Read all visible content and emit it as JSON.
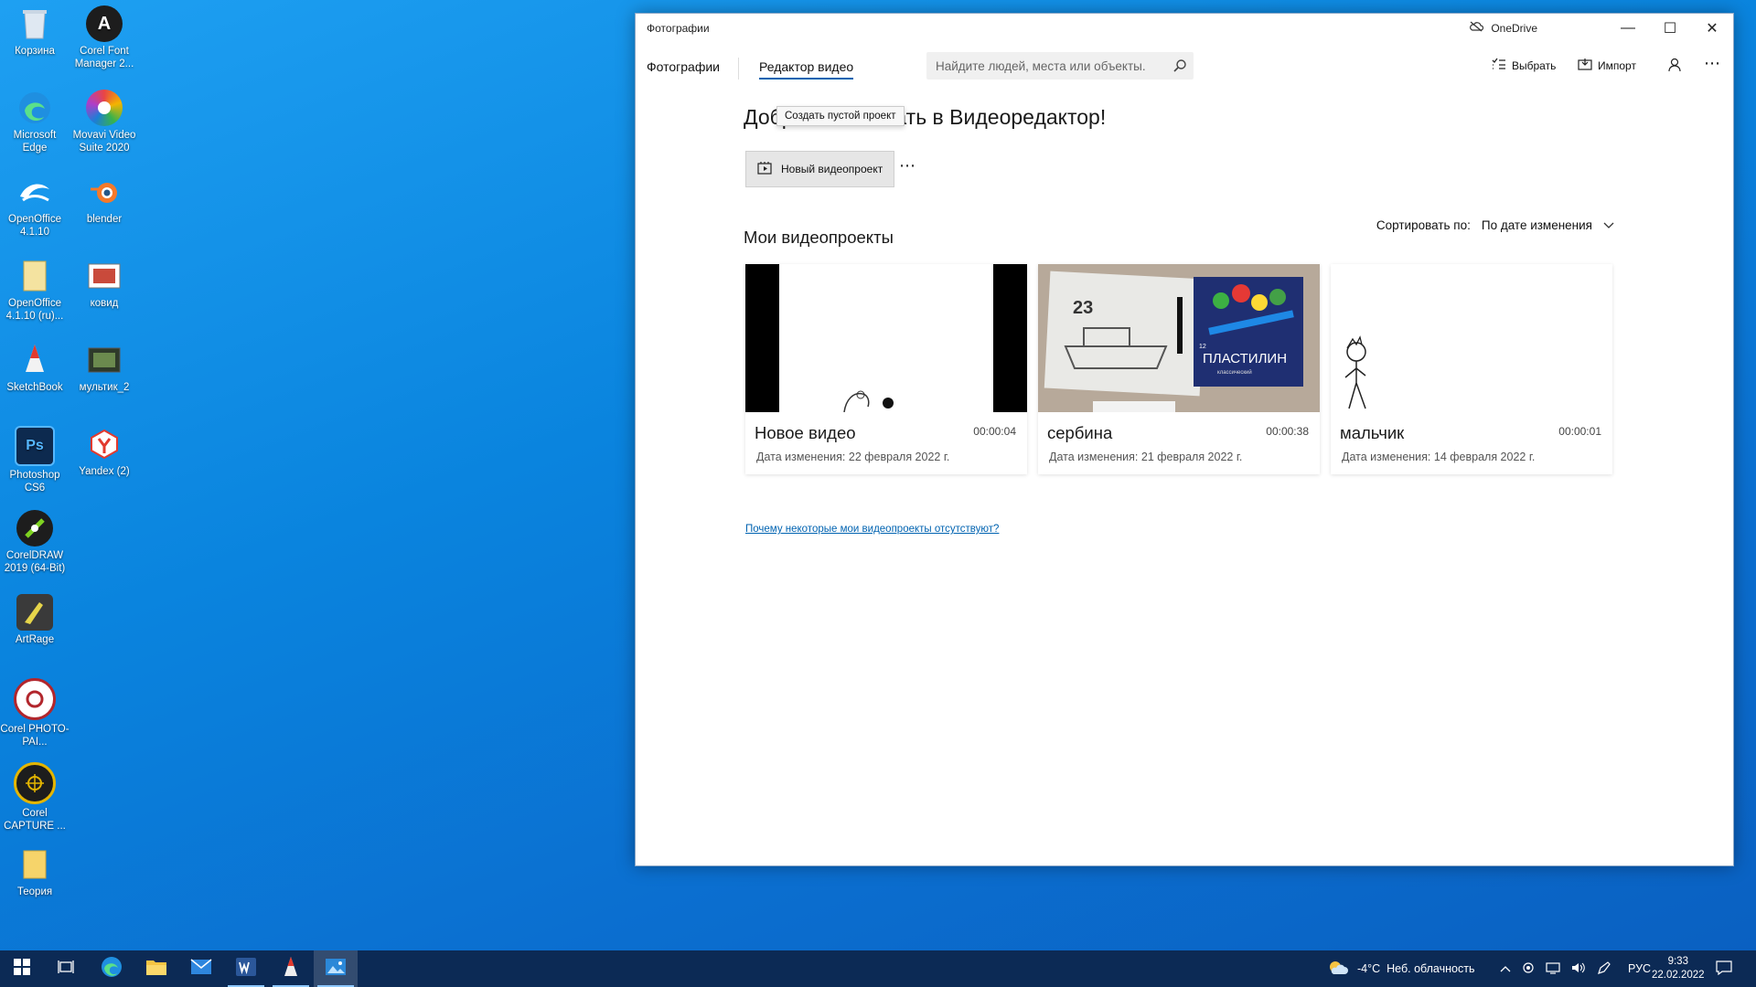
{
  "desktop": {
    "icons": [
      {
        "label": "Корзина",
        "icon": "recycle-bin-icon"
      },
      {
        "label": "Corel Font Manager 2...",
        "icon": "corel-font-manager-icon"
      },
      {
        "label": "Microsoft Edge",
        "icon": "edge-icon"
      },
      {
        "label": "Movavi Video Suite 2020",
        "icon": "movavi-icon"
      },
      {
        "label": "OpenOffice 4.1.10",
        "icon": "openoffice-icon"
      },
      {
        "label": "blender",
        "icon": "blender-icon"
      },
      {
        "label": "OpenOffice 4.1.10 (ru)...",
        "icon": "openoffice-folder-icon"
      },
      {
        "label": "ковид",
        "icon": "image-file-icon"
      },
      {
        "label": "SketchBook",
        "icon": "sketchbook-icon"
      },
      {
        "label": "мультик_2",
        "icon": "video-file-icon"
      },
      {
        "label": "Photoshop CS6",
        "icon": "photoshop-icon"
      },
      {
        "label": "Yandex (2)",
        "icon": "yandex-icon"
      },
      {
        "label": "CorelDRAW 2019 (64-Bit)",
        "icon": "coreldraw-icon"
      },
      {
        "label": "ArtRage",
        "icon": "artrage-icon"
      },
      {
        "label": "Corel PHOTO-PAI...",
        "icon": "corel-photopaint-icon"
      },
      {
        "label": "Corel CAPTURE ...",
        "icon": "corel-capture-icon"
      },
      {
        "label": "Теория",
        "icon": "folder-icon"
      }
    ]
  },
  "window": {
    "title": "Фотографии",
    "onedrive": "OneDrive",
    "controls": {
      "minimize": "—",
      "maximize": "☐",
      "close": "✕"
    }
  },
  "nav": {
    "tabs": [
      {
        "label": "Фотографии"
      },
      {
        "label": "Редактор видео"
      }
    ],
    "search_placeholder": "Найдите людей, места или объекты.",
    "select_label": "Выбрать",
    "import_label": "Импорт",
    "more": "⋯"
  },
  "main": {
    "welcome": "Добро пожаловать в Видеоредактор!",
    "tooltip": "Создать пустой проект",
    "new_project_label": "Новый видеопроект",
    "more": "⋯",
    "section_title": "Мои видеопроекты",
    "sort_label": "Сортировать по:",
    "sort_value": "По дате изменения",
    "projects": [
      {
        "title": "Новое видео",
        "duration": "00:00:04",
        "date": "Дата изменения: 22 февраля 2022 г."
      },
      {
        "title": "сербина",
        "duration": "00:00:38",
        "date": "Дата изменения: 21 февраля 2022 г."
      },
      {
        "title": "мальчик",
        "duration": "00:00:01",
        "date": "Дата изменения: 14 февраля 2022 г."
      }
    ],
    "missing_link": "Почему некоторые мои видеопроекты отсутствуют?",
    "thumb_text": {
      "number": "23",
      "box_label": "ПЛАСТИЛИН",
      "box_sub": "классический",
      "count": "12"
    }
  },
  "taskbar": {
    "weather_temp": "-4°C",
    "weather_text": "Неб. облачность",
    "language": "РУС",
    "time": "9:33",
    "date": "22.02.2022"
  },
  "colors": {
    "accent": "#0063b1",
    "taskbar": "#0c2a55"
  }
}
